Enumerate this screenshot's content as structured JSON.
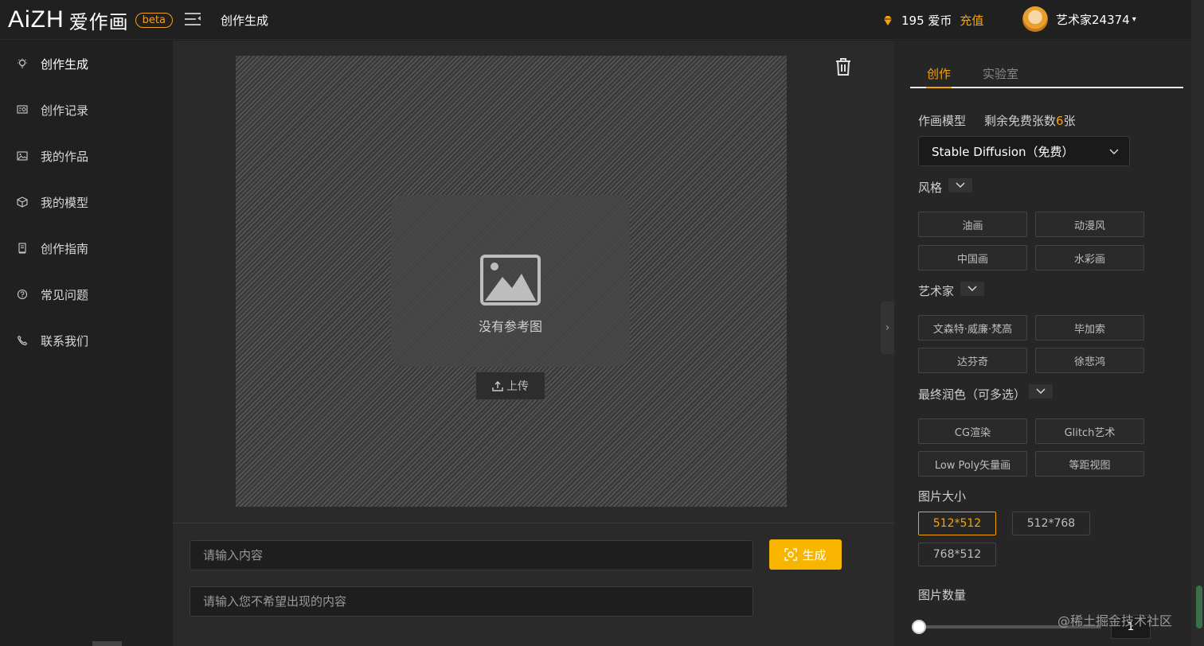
{
  "header": {
    "logo_mark": "AiZH",
    "logo_cn": "爱作画",
    "beta": "beta",
    "title": "创作生成",
    "coins": "195 爱币",
    "recharge": "充值",
    "username": "艺术家24374",
    "caret": "▾"
  },
  "sidebar": {
    "items": [
      {
        "label": "创作生成",
        "icon": "bulb-icon"
      },
      {
        "label": "创作记录",
        "icon": "record-icon"
      },
      {
        "label": "我的作品",
        "icon": "image-icon"
      },
      {
        "label": "我的模型",
        "icon": "cube-icon"
      },
      {
        "label": "创作指南",
        "icon": "book-icon"
      },
      {
        "label": "常见问题",
        "icon": "question-icon"
      },
      {
        "label": "联系我们",
        "icon": "phone-icon"
      }
    ]
  },
  "main": {
    "no_reference": "没有参考图",
    "upload": "上传",
    "prompt_placeholder": "请输入内容",
    "negative_placeholder": "请输入您不希望出现的内容",
    "generate": "生成"
  },
  "panel": {
    "tabs": [
      "创作",
      "实验室"
    ],
    "model_label": "作画模型",
    "quota_prefix": "剩余免费张数",
    "quota_num": "6",
    "quota_suffix": "张",
    "model_value": "Stable Diffusion（免费）",
    "style_label": "风格",
    "styles": [
      "油画",
      "动漫风",
      "中国画",
      "水彩画"
    ],
    "artist_label": "艺术家",
    "artists": [
      "文森特·威廉·梵高",
      "毕加索",
      "达芬奇",
      "徐悲鸿"
    ],
    "finish_label": "最终润色（可多选）",
    "finishes": [
      "CG渲染",
      "Glitch艺术",
      "Low Poly矢量画",
      "等距视图"
    ],
    "size_label": "图片大小",
    "sizes": [
      "512*512",
      "512*768",
      "768*512"
    ],
    "count_label": "图片数量",
    "count_value": "1",
    "count_level": 0
  },
  "watermark": "@稀土掘金技术社区",
  "colors": {
    "accent": "#f7a400",
    "generate_bg": "#f7b500"
  }
}
